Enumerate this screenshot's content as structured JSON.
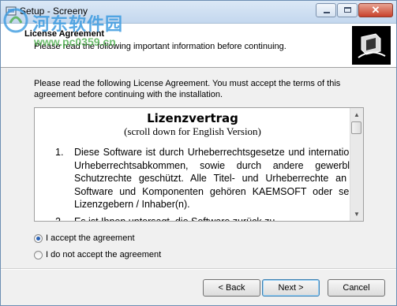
{
  "window": {
    "title": "Setup - Screeny",
    "watermark_text": "河东软件园",
    "watermark_url": "www.pc0359.cn"
  },
  "header": {
    "title": "License Agreement",
    "subtitle": "Please read the following important information before continuing."
  },
  "instructions": "Please read the following License Agreement. You must accept the terms of this agreement before continuing with the installation.",
  "license": {
    "heading": "Lizenzvertrag",
    "subheading": "(scroll down for English Version)",
    "items": [
      {
        "num": "1.",
        "text": "Diese Software ist durch Urheberrechtsgesetze und internationale Urheberrechtsabkommen, sowie durch andere gewerbliche Schutzrechte geschützt. Alle Titel- und Urheberrechte an der Software und Komponenten gehören KAEMSOFT oder seinen Lizenzgebern / Inhaber(n)."
      },
      {
        "num": "2.",
        "text": "Es ist Ihnen untersagt, die Software zurück zu"
      }
    ]
  },
  "options": {
    "accept": "I accept the agreement",
    "decline": "I do not accept the agreement",
    "selected": "accept"
  },
  "buttons": {
    "back": "< Back",
    "next": "Next >",
    "cancel": "Cancel"
  },
  "colors": {
    "accent": "#2a62b5",
    "titlebar": "#c3d7ee"
  }
}
